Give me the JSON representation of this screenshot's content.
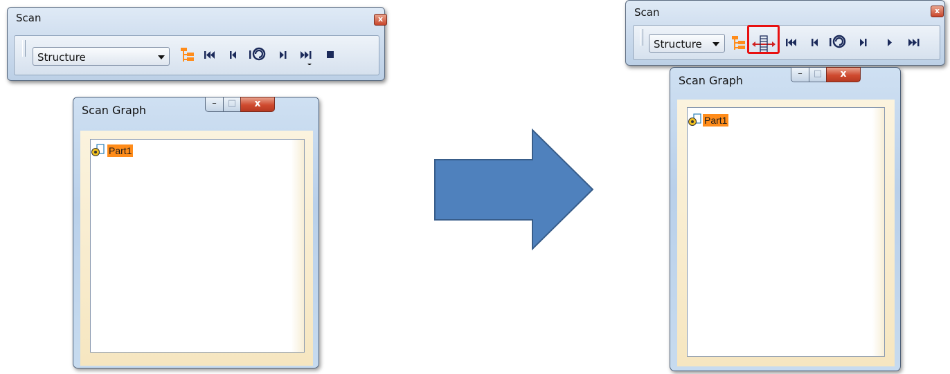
{
  "left": {
    "toolbar": {
      "title": "Scan",
      "close_glyph": "x",
      "combo_value": "Structure",
      "buttons": [
        "tree-icon",
        "first-step-icon",
        "previous-step-icon",
        "update-step-icon",
        "next-step-icon",
        "last-step-icon",
        "stop-icon"
      ]
    },
    "window": {
      "title": "Scan Graph",
      "minimize_glyph": "–",
      "maximize_glyph": "□",
      "close_glyph": "x",
      "tree_item": "Part1"
    }
  },
  "right": {
    "toolbar": {
      "title": "Scan",
      "close_glyph": "x",
      "combo_value": "Structure",
      "buttons": [
        "tree-icon",
        "scan-steps-icon",
        "first-step-icon",
        "previous-step-icon",
        "update-step-icon",
        "next-step-icon",
        "play-icon",
        "last-step-icon"
      ],
      "highlighted_button": "scan-steps-icon",
      "highlight_color": "#e81010"
    },
    "window": {
      "title": "Scan Graph",
      "minimize_glyph": "–",
      "maximize_glyph": "□",
      "close_glyph": "x",
      "tree_item": "Part1"
    }
  },
  "arrow": {
    "color": "#4f81bd",
    "border_color": "#385d8a",
    "direction": "right"
  },
  "accent_orange": "#ff8c1a"
}
